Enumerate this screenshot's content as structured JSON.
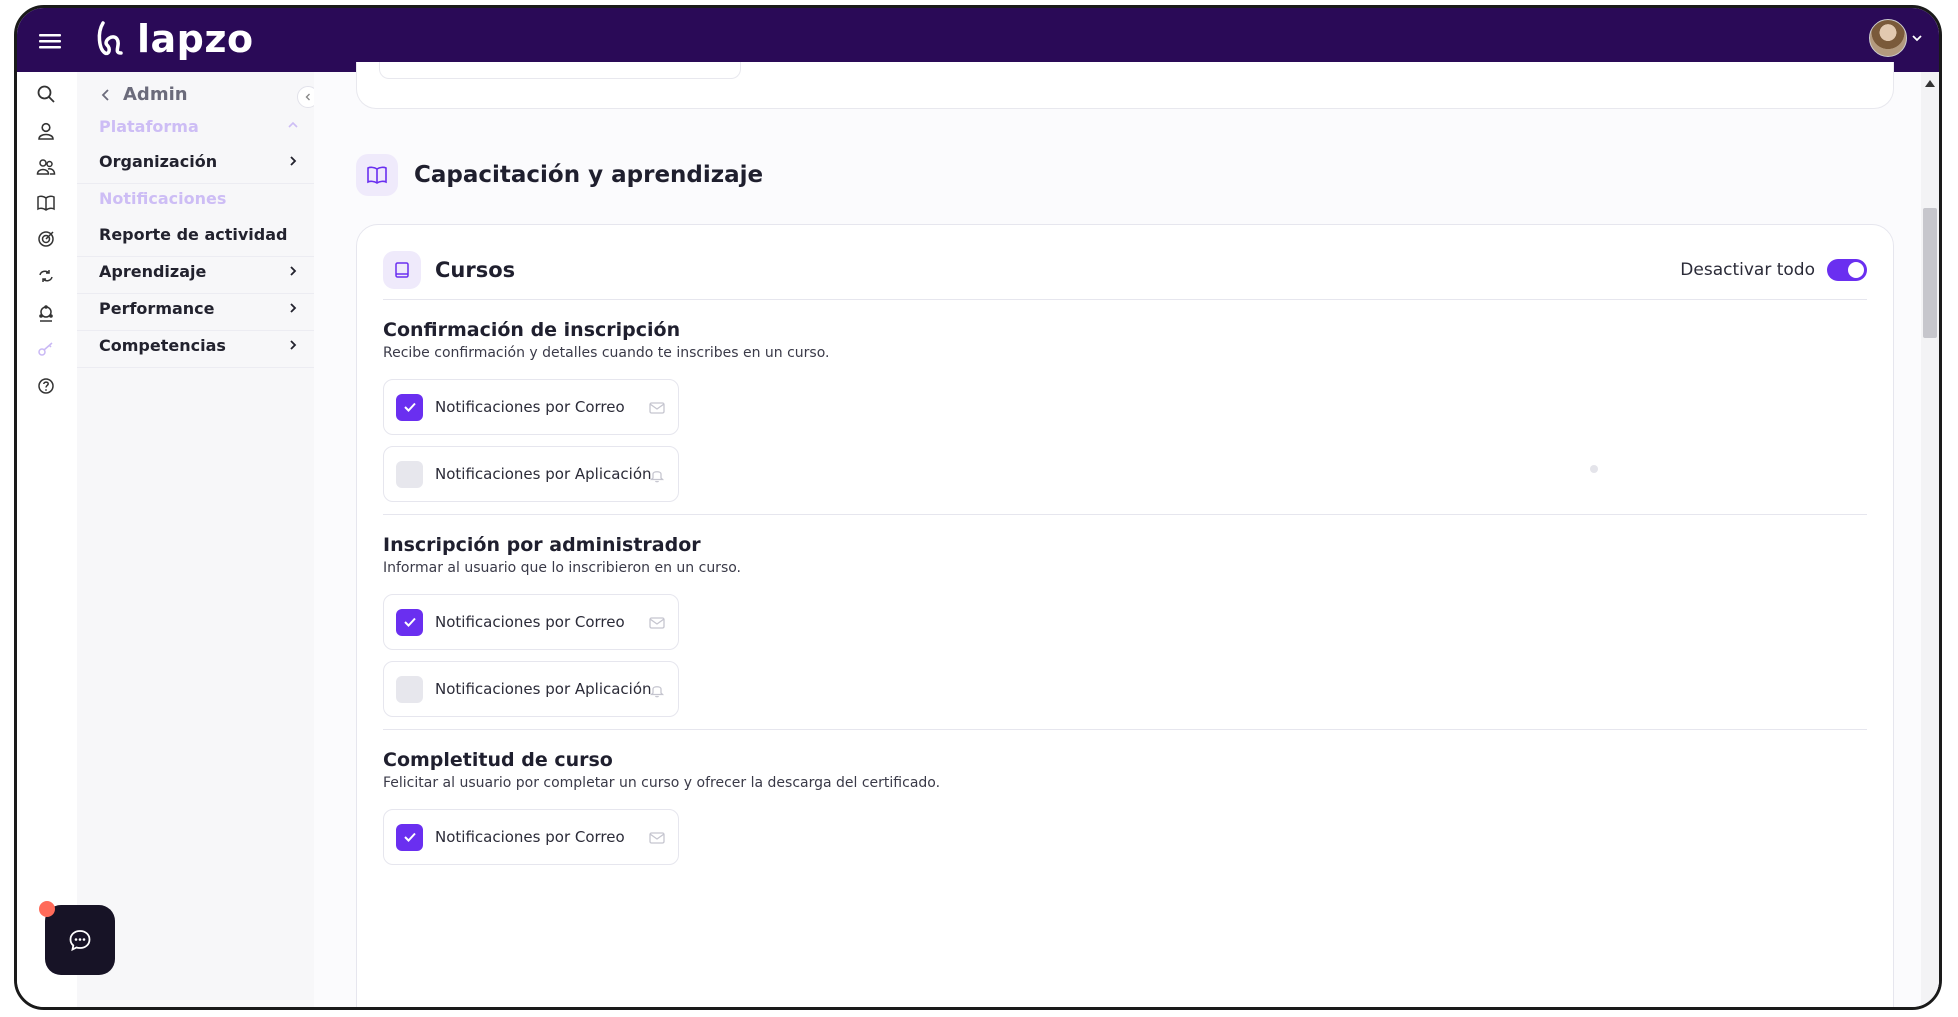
{
  "app": {
    "brand": "lapzo"
  },
  "sidebar": {
    "back_label": "Admin",
    "items": [
      {
        "label": "Plataforma",
        "state": "faded",
        "chevron": "chevron-up"
      },
      {
        "label": "Organización",
        "chevron": "chevron-right"
      },
      {
        "label": "Notificaciones",
        "state": "faded"
      },
      {
        "label": "Reporte de actividad"
      },
      {
        "label": "Aprendizaje",
        "chevron": "chevron-right"
      },
      {
        "label": "Performance",
        "chevron": "chevron-right"
      },
      {
        "label": "Competencias",
        "chevron": "chevron-right"
      }
    ]
  },
  "rail_icons": [
    "search-icon",
    "user-icon",
    "users-icon",
    "book-icon",
    "target-icon",
    "refresh-icon",
    "network-icon",
    "key-icon",
    "help-icon"
  ],
  "section": {
    "title": "Capacitación y aprendizaje",
    "icon": "book-open-icon"
  },
  "card": {
    "title": "Cursos",
    "icon": "book-icon",
    "toggle_label": "Desactivar todo",
    "toggle_on": true,
    "accent_color": "#6a2ff0",
    "blocks": [
      {
        "title": "Confirmación de inscripción",
        "description": "Recibe confirmación y detalles cuando te inscribes en un curso.",
        "options": [
          {
            "label": "Notificaciones por Correo",
            "checked": true,
            "icon": "mail-icon"
          },
          {
            "label": "Notificaciones por Aplicación",
            "checked": false,
            "icon": "bell-icon"
          }
        ]
      },
      {
        "title": "Inscripción por administrador",
        "description": "Informar al usuario que lo inscribieron en un curso.",
        "options": [
          {
            "label": "Notificaciones por Correo",
            "checked": true,
            "icon": "mail-icon"
          },
          {
            "label": "Notificaciones por Aplicación",
            "checked": false,
            "icon": "bell-icon"
          }
        ]
      },
      {
        "title": "Completitud de curso",
        "description": "Felicitar al usuario por completar un curso y ofrecer la descarga del certificado.",
        "options": [
          {
            "label": "Notificaciones por Correo",
            "checked": true,
            "icon": "mail-icon"
          }
        ]
      }
    ]
  },
  "colors": {
    "topbar": "#2a0a57",
    "accent": "#6a2ff0",
    "faded_nav": "#cdbdf5"
  }
}
